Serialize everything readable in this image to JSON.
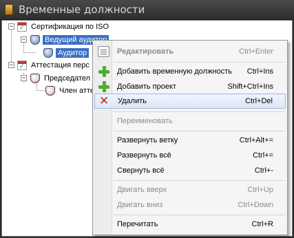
{
  "window": {
    "title": "Временные должности"
  },
  "tree": {
    "nodes": [
      {
        "label": "Сертификация по ISO"
      },
      {
        "label": "Ведущий аудитор"
      },
      {
        "label": "Аудитор"
      },
      {
        "label": "Аттестация перс"
      },
      {
        "label": "Председател"
      },
      {
        "label": "Член атте"
      }
    ]
  },
  "menu": {
    "items": [
      {
        "label": "Редактировать",
        "shortcut": "Ctrl+Enter",
        "icon": "edit-icon"
      },
      {
        "label": "Добавить временную должность",
        "shortcut": "Ctrl+Ins",
        "icon": "plus-icon"
      },
      {
        "label": "Добавить проект",
        "shortcut": "Shift+Ctrl+Ins",
        "icon": "plus-icon"
      },
      {
        "label": "Удалить",
        "shortcut": "Ctrl+Del",
        "icon": "delete-icon"
      },
      {
        "label": "Переименовать",
        "shortcut": ""
      },
      {
        "label": "Развернуть ветку",
        "shortcut": "Ctrl+Alt+="
      },
      {
        "label": "Развернуть всё",
        "shortcut": "Ctrl+="
      },
      {
        "label": "Свернуть всё",
        "shortcut": "Ctrl+-"
      },
      {
        "label": "Двигать вверх",
        "shortcut": "Ctrl+Up"
      },
      {
        "label": "Двигать вниз",
        "shortcut": "Ctrl+Down"
      },
      {
        "label": "Перечитать",
        "shortcut": "Ctrl+R"
      }
    ]
  },
  "colors": {
    "selection": "#3a6fc4",
    "highlight": "#dce8f8",
    "accent_red": "#cc1f1f",
    "accent_green": "#4caf2a"
  }
}
